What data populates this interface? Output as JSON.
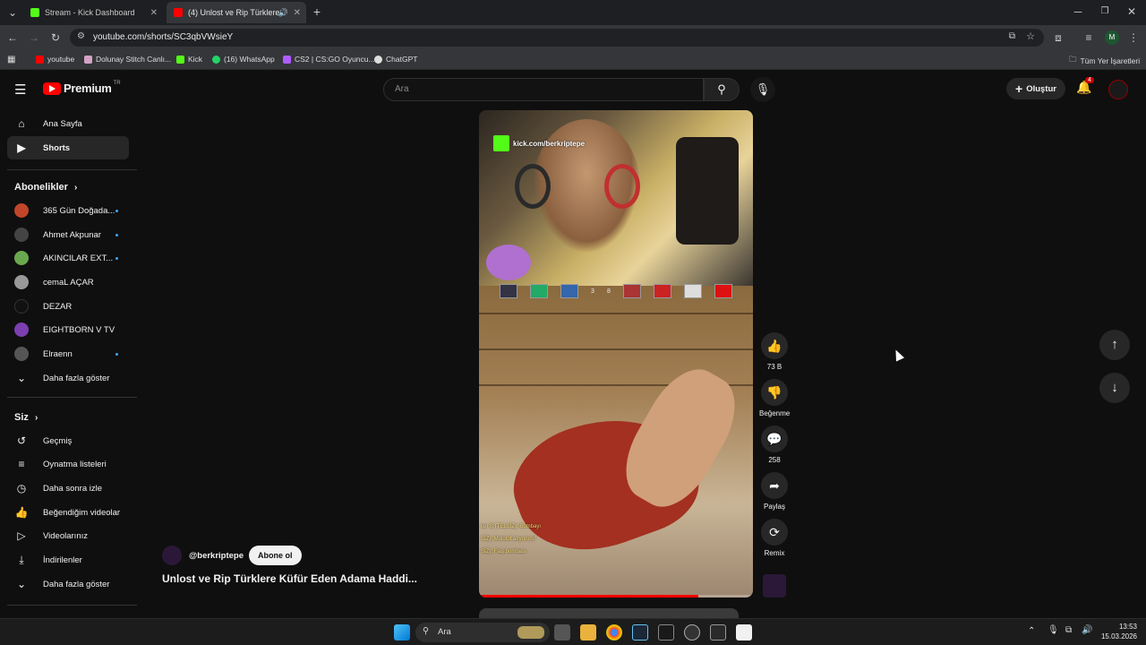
{
  "browser": {
    "tabs": [
      {
        "title": "Stream - Kick Dashboard",
        "favicon_color": "#53fc18"
      },
      {
        "title": "(4) Unlost ve Rip Türklere K",
        "favicon_color": "#ff0000"
      }
    ],
    "url": "youtube.com/shorts/SC3qbVWsieY",
    "bookmarks": [
      {
        "label": "youtube",
        "color": "#ff0000"
      },
      {
        "label": "Dolunay Stitch Canlı...",
        "color": "#d4a3c7"
      },
      {
        "label": "Kick",
        "color": "#53fc18"
      },
      {
        "label": "(16) WhatsApp",
        "color": "#25d366"
      },
      {
        "label": "CS2 | CS:GO Oyuncu...",
        "color": "#b05cff"
      },
      {
        "label": "ChatGPT",
        "color": "#dddddd"
      }
    ],
    "all_bookmarks": "Tüm Yer İşaretleri"
  },
  "youtube": {
    "logo": "Premium",
    "logo_sup": "TR",
    "search_placeholder": "Ara",
    "create_label": "Oluştur",
    "notif_count": "4",
    "nav": [
      {
        "label": "Ana Sayfa",
        "icon": "home-icon"
      },
      {
        "label": "Shorts",
        "icon": "shorts-icon"
      }
    ],
    "subs_title": "Abonelikler",
    "subs": [
      {
        "name": "365 Gün Doğada...",
        "color": "#c0452a",
        "live": true
      },
      {
        "name": "Ahmet Akpunar",
        "color": "#444444",
        "live": true
      },
      {
        "name": "AKINCILAR EXT...",
        "color": "#6aa84f",
        "live": true
      },
      {
        "name": "cemaL AÇAR",
        "color": "#999999",
        "live": false
      },
      {
        "name": "DEZAR",
        "color": "#111111",
        "live": false
      },
      {
        "name": "EIGHTBORN V TV",
        "color": "#7b3fb0",
        "live": false
      },
      {
        "name": "Elraenn",
        "color": "#555555",
        "live": true
      }
    ],
    "subs_more": "Daha fazla göster",
    "you_title": "Siz",
    "you_items": [
      {
        "label": "Geçmiş",
        "icon": "history-icon"
      },
      {
        "label": "Oynatma listeleri",
        "icon": "playlist-icon"
      },
      {
        "label": "Daha sonra izle",
        "icon": "clock-icon"
      },
      {
        "label": "Beğendiğim videolar",
        "icon": "like-icon"
      },
      {
        "label": "Videolarınız",
        "icon": "video-icon"
      },
      {
        "label": "İndirilenler",
        "icon": "download-icon"
      },
      {
        "label": "Daha fazla göster",
        "icon": "chevron-down-icon"
      }
    ],
    "short": {
      "channel": "@berkriptepe",
      "subscribe": "Abone ol",
      "title": "Unlost ve Rip Türklere Küfür Eden Adama Haddi...",
      "overlay_url": "kick.com/berkriptepe",
      "chat_lines": [
        "ları B (TELSİZ): Bombayı",
        "SİZ): Molotof atıyorum!",
        "SİZ): Flaş bombası"
      ],
      "hud_numbers": [
        "3",
        "8"
      ],
      "progress_fraction": 0.8
    },
    "actions": [
      {
        "label": "73 B",
        "icon": "thumbs-up-icon"
      },
      {
        "label": "Beğenme",
        "icon": "thumbs-down-icon"
      },
      {
        "label": "258",
        "icon": "comment-icon"
      },
      {
        "label": "Paylaş",
        "icon": "share-icon"
      },
      {
        "label": "Remix",
        "icon": "remix-icon"
      }
    ]
  },
  "taskbar": {
    "search_label": "Ara",
    "time": "13:53",
    "date": "15.03.2026"
  }
}
